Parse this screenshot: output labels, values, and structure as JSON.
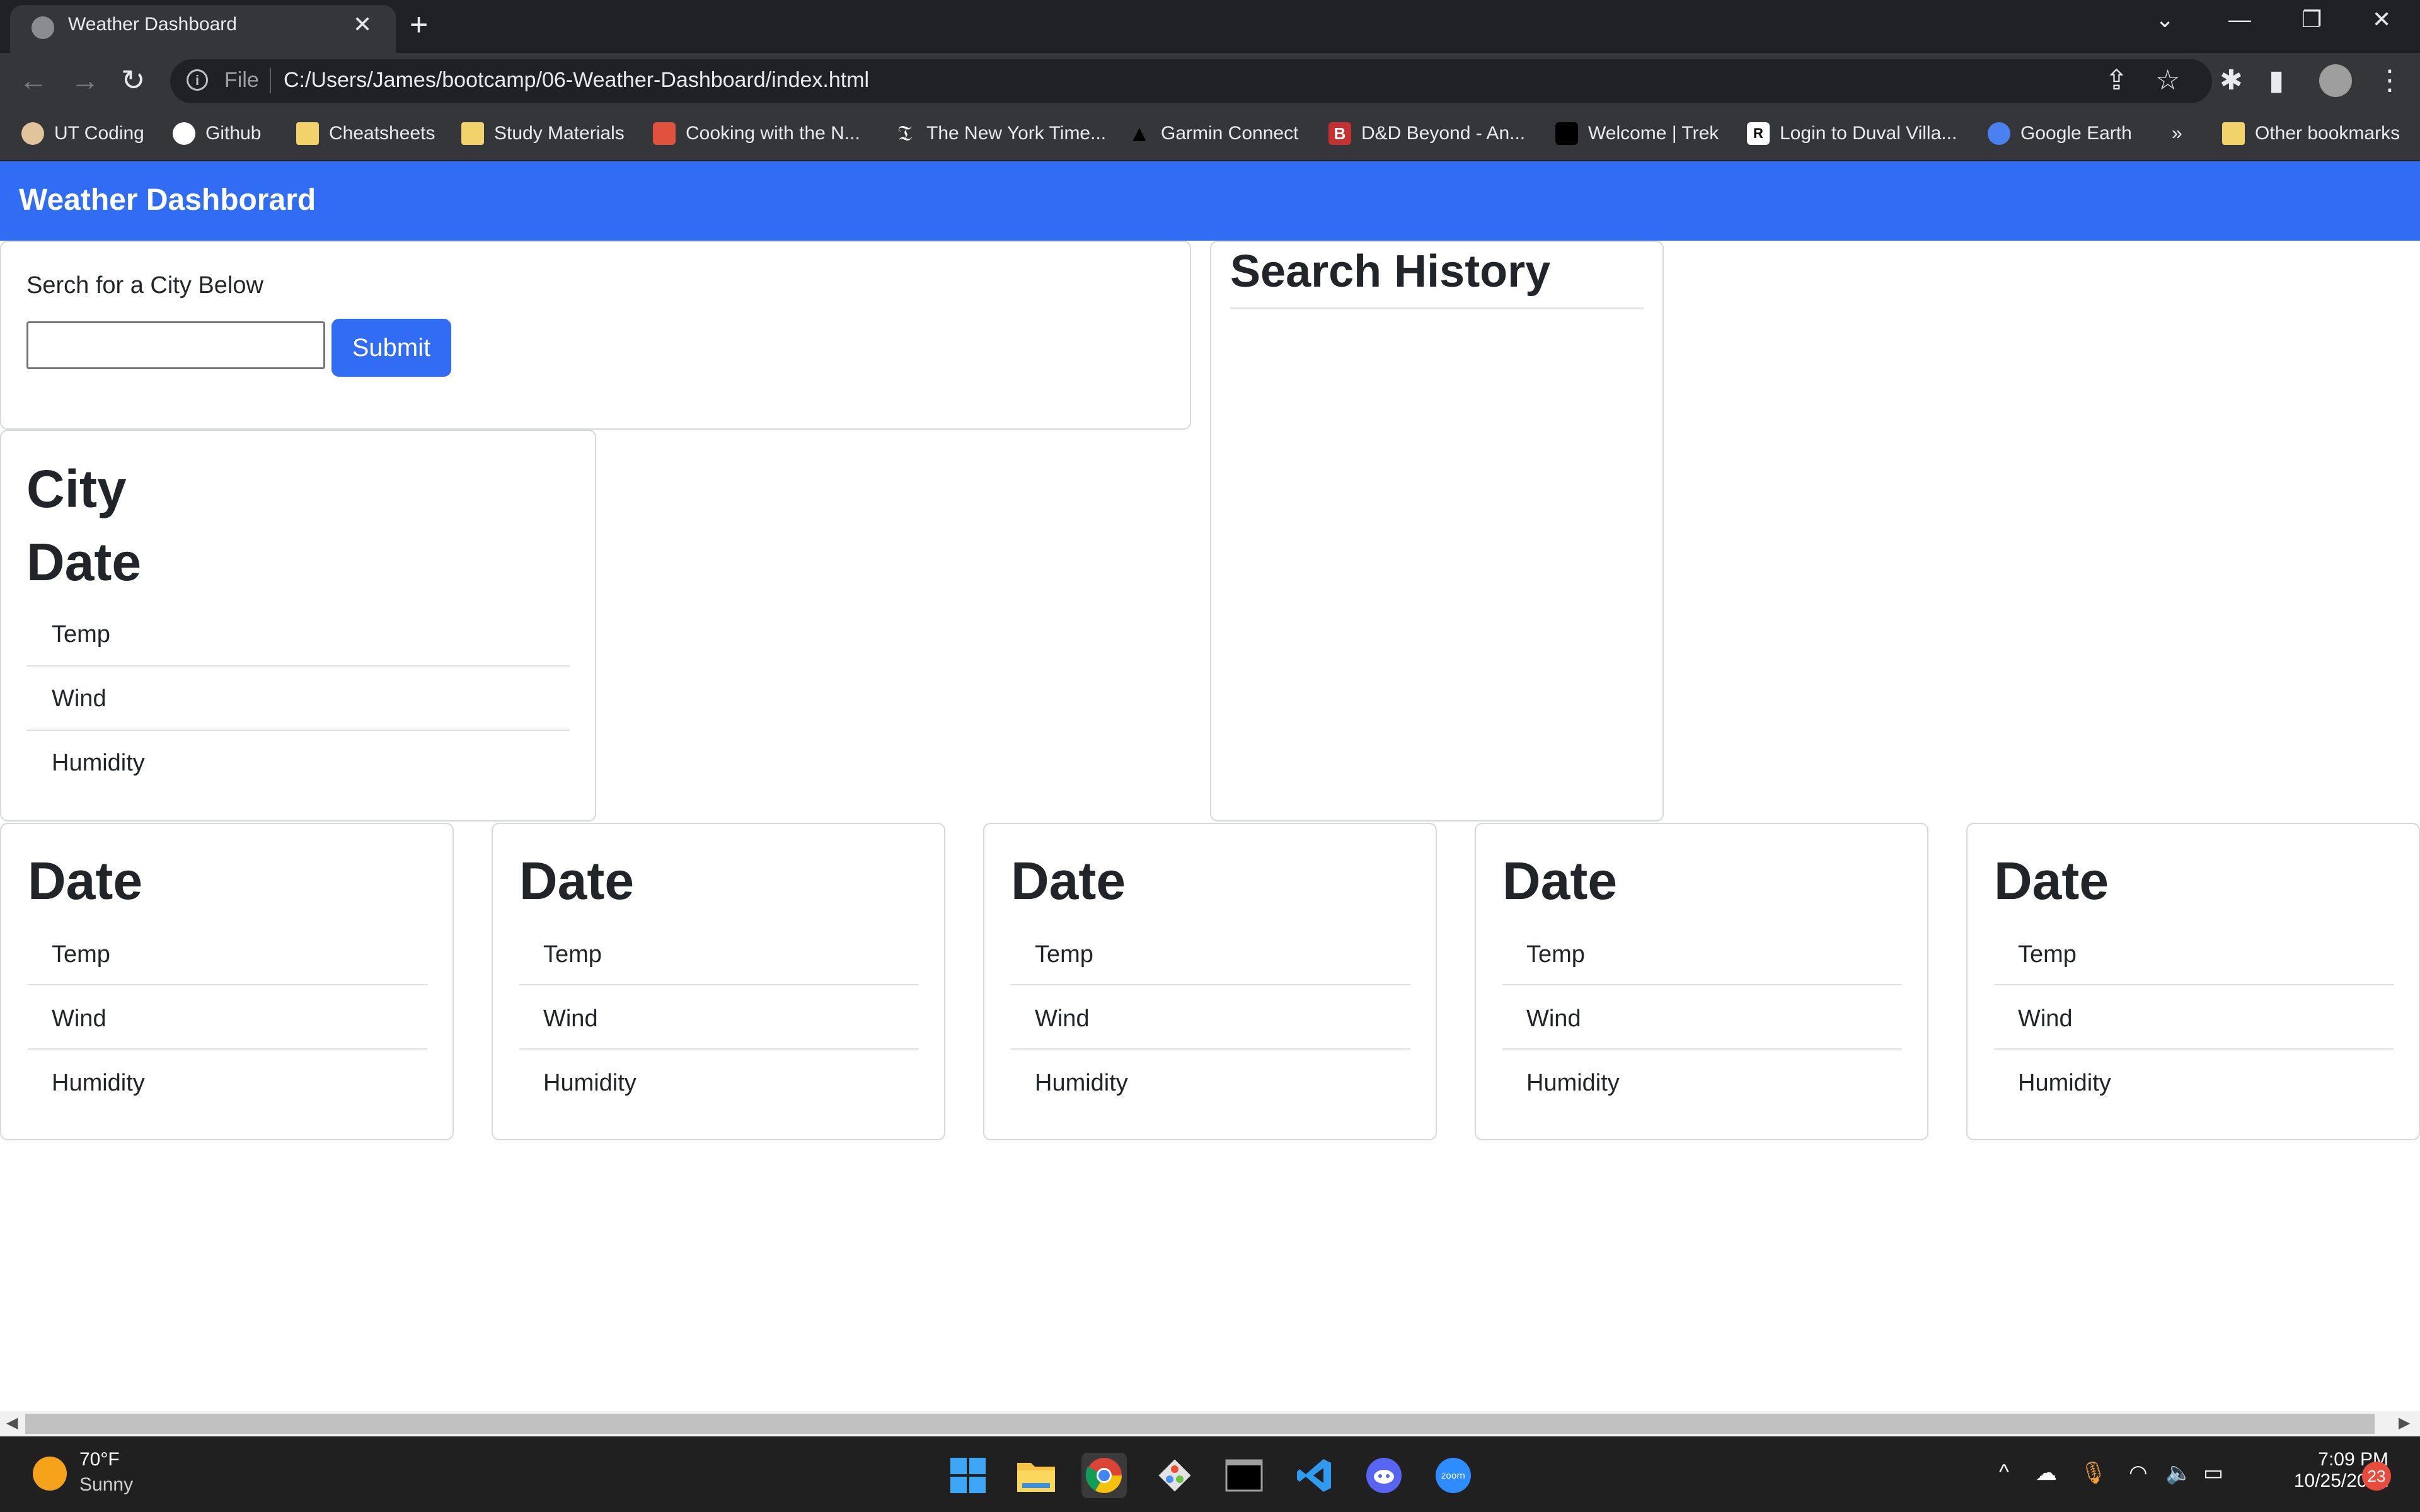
{
  "browser": {
    "tab_title": "Weather Dashboard",
    "tab_close": "✕",
    "new_tab": "+",
    "file_label": "File",
    "url": "C:/Users/James/bootcamp/06-Weather-Dashboard/index.html",
    "bookmarks": [
      {
        "label": "UT Coding",
        "icon": "ut-coding-icon",
        "color": "#e0c49c"
      },
      {
        "label": "Github",
        "icon": "github-icon",
        "color": "#ffffff"
      },
      {
        "label": "Cheatsheets",
        "icon": "folder-icon",
        "color": "#f2d36b"
      },
      {
        "label": "Study Materials",
        "icon": "folder-icon",
        "color": "#f2d36b"
      },
      {
        "label": "Cooking with the N...",
        "icon": "nyt-cooking-icon",
        "color": "#e0523d"
      },
      {
        "label": "The New York Time...",
        "icon": "nyt-icon",
        "color": "#ffffff"
      },
      {
        "label": "Garmin Connect",
        "icon": "garmin-icon",
        "color": "#000000"
      },
      {
        "label": "D&D Beyond - An...",
        "icon": "dnd-beyond-icon",
        "color": "#c53131"
      },
      {
        "label": "Welcome | Trek",
        "icon": "trek-icon",
        "color": "#000000"
      },
      {
        "label": "Login to Duval Villa...",
        "icon": "duval-icon",
        "color": "#ffffff"
      },
      {
        "label": "Google Earth",
        "icon": "google-earth-icon",
        "color": "#4a80f0"
      }
    ],
    "more_bookmarks": "»",
    "other_bookmarks": "Other bookmarks"
  },
  "page": {
    "brand": "Weather Dashborard",
    "search_label": "Serch for a City Below",
    "city_input_value": "",
    "submit_label": "Submit",
    "history_title": "Search History",
    "current": {
      "city": "City",
      "date": "Date",
      "items": [
        "Temp",
        "Wind",
        "Humidity"
      ]
    },
    "forecast": [
      {
        "date": "Date",
        "items": [
          "Temp",
          "Wind",
          "Humidity"
        ]
      },
      {
        "date": "Date",
        "items": [
          "Temp",
          "Wind",
          "Humidity"
        ]
      },
      {
        "date": "Date",
        "items": [
          "Temp",
          "Wind",
          "Humidity"
        ]
      },
      {
        "date": "Date",
        "items": [
          "Temp",
          "Wind",
          "Humidity"
        ]
      },
      {
        "date": "Date",
        "items": [
          "Temp",
          "Wind",
          "Humidity"
        ]
      }
    ]
  },
  "taskbar": {
    "weather_temp": "70°F",
    "weather_condition": "Sunny",
    "time": "7:09 PM",
    "date": "10/25/2022",
    "notification_count": "23",
    "apps": [
      "start-icon",
      "file-explorer-icon",
      "chrome-icon",
      "git-icon",
      "terminal-icon",
      "vscode-icon",
      "discord-icon",
      "zoom-icon"
    ]
  },
  "colors": {
    "navbar": "#316cf4",
    "button": "#316cf4",
    "chrome_dark": "#202124",
    "chrome_toolbar": "#35363a"
  }
}
